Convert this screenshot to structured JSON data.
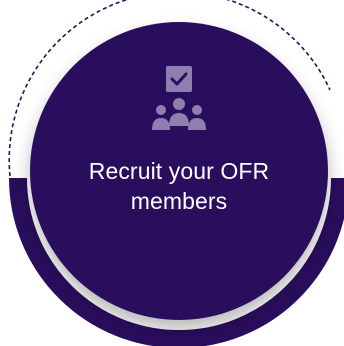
{
  "card": {
    "title_line1": "Recruit your OFR",
    "title_line2": "members",
    "icon": "team-checkbox-icon",
    "colors": {
      "disc": "#2a0e5e",
      "ring": "#2a0e5e",
      "icon": "#8e7fb0",
      "text": "#ffffff",
      "dashed": "#2a0e5e"
    }
  }
}
